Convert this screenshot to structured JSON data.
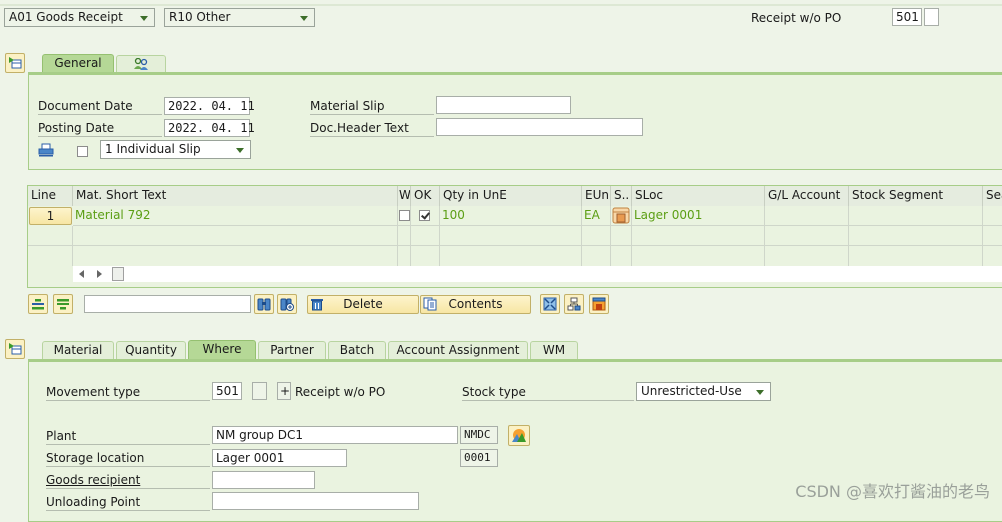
{
  "header": {
    "action_select": "A01 Goods Receipt",
    "reference_select": "R10 Other",
    "movement_label": "Receipt w/o PO",
    "movement_code": "501",
    "movement_special": ""
  },
  "header_tabs": [
    {
      "label": "General",
      "active": true
    },
    {
      "label": "",
      "icon": "partners-icon",
      "active": false
    }
  ],
  "general": {
    "document_date_label": "Document Date",
    "document_date": "2022. 04. 11",
    "posting_date_label": "Posting Date",
    "posting_date": "2022. 04. 11",
    "material_slip_label": "Material Slip",
    "material_slip": "",
    "doc_header_text_label": "Doc.Header Text",
    "doc_header_text": "",
    "print_checked": false,
    "slip_select": "1 Individual Slip"
  },
  "items_table": {
    "columns": [
      "Line",
      "Mat. Short Text",
      "W",
      "OK",
      "Qty in UnE",
      "EUn",
      "S..",
      "SLoc",
      "G/L Account",
      "Stock Segment",
      "Sea"
    ],
    "rows": [
      {
        "line": "1",
        "mat_short_text": "Material 792",
        "w": false,
        "ok": true,
        "qty": "100",
        "eun": "EA",
        "sloc": "Lager 0001",
        "gl_account": "",
        "stock_segment": ""
      }
    ]
  },
  "toolbar": {
    "search_value": "",
    "delete_label": "Delete",
    "contents_label": "Contents"
  },
  "detail_tabs": [
    {
      "label": "Material",
      "active": false
    },
    {
      "label": "Quantity",
      "active": false
    },
    {
      "label": "Where",
      "active": true
    },
    {
      "label": "Partner",
      "active": false
    },
    {
      "label": "Batch",
      "active": false
    },
    {
      "label": "Account Assignment",
      "active": false
    },
    {
      "label": "WM",
      "active": false
    }
  ],
  "where": {
    "movement_type_label": "Movement type",
    "movement_type": "501",
    "movement_special": "",
    "plus_sign": "+",
    "movement_desc": "Receipt w/o PO",
    "stock_type_label": "Stock type",
    "stock_type": "Unrestricted-Use",
    "plant_label": "Plant",
    "plant_name": "NM group DC1",
    "plant_code": "NMDC",
    "storage_location_label": "Storage location",
    "storage_location_name": "Lager 0001",
    "storage_location_code": "0001",
    "goods_recipient_label": "Goods recipient",
    "goods_recipient": "",
    "unloading_point_label": "Unloading Point",
    "unloading_point": ""
  },
  "watermark": "CSDN @喜欢打酱油的老鸟",
  "colors": {
    "background": "#eef4e8",
    "accent_green": "#a7cd88",
    "value_green": "#5b9e14",
    "button_yellow": "#fbf1c4"
  }
}
